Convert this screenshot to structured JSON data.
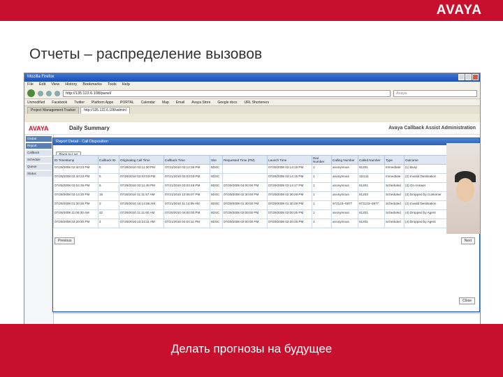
{
  "logo": "AVAYA",
  "slide_title": "Отчеты – распределение вызовов",
  "caption": "Делать прогнозы на будущее",
  "browser": {
    "menu": [
      "File",
      "Edit",
      "View",
      "History",
      "Bookmarks",
      "Tools",
      "Help"
    ],
    "url": "http://135.122.6.108/panel/",
    "search_placeholder": "Avaya",
    "bookmarks": [
      "Unmodified",
      "Facebook",
      "Twitter",
      "Platform Apps",
      "PORTAL",
      "Calendar",
      "Map",
      "Email",
      "Avaya Store",
      "Google docs",
      "URL Shorteners"
    ],
    "tabs": [
      "Project Management Tracker",
      "http://135.122.6.108/admin/"
    ]
  },
  "app": {
    "logo": "AVAYA",
    "title": "Avaya Callback Assist Administration",
    "page": "Daily Summary",
    "sidebar": [
      "Global",
      "Report",
      "Callback",
      "Schedule",
      "Queue",
      "Status"
    ]
  },
  "report": {
    "title": "Report Detail - Call Disposition",
    "back_label": "Back to List",
    "headers": [
      "ID Timestamp",
      "Callback ID",
      "Originating Call Time",
      "Callback Time",
      "Site",
      "Requested Time (PM)",
      "Launch Time",
      "Dial Number",
      "Calling Number",
      "Called Number",
      "Type",
      "Outcome"
    ],
    "rows": [
      [
        "07/29/2008 02:40:23 PM",
        "6",
        "07/28/2010 03:11:30 PM",
        "07/21/2010 03:12:39 PM",
        "6DSC",
        "",
        "07/29/2008 02:14:15 PM",
        "1",
        "anonymous",
        "61201",
        "Immediate",
        "(1) Busy"
      ],
      [
        "07/29/2008 02:40:23 PM",
        "5",
        "07/29/2010 02:03:03 PM",
        "07/21/2010 03:03:03 PM",
        "6DSC",
        "",
        "07/29/2008 02:14:15 PM",
        "1",
        "anonymous",
        "111111",
        "Immediate",
        "(2) Invalid Destination"
      ],
      [
        "07/29/2008 02:04:35 PM",
        "5",
        "07/28/2010 02:11:48 PM",
        "07/21/2010 03:03:48 PM",
        "6DSC",
        "07/29/2008 04:00:00 PM",
        "07/29/2008 02:14:17 PM",
        "1",
        "anonymous",
        "61201",
        "Scheduled",
        "(3) On Answer"
      ],
      [
        "07/29/2008 02:14:30 PM",
        "15",
        "07/28/2010 11:11:57 AM",
        "07/21/2010 12:06:07 PM",
        "6DSC",
        "07/29/2008 02:30:00 PM",
        "07/29/2008 02:30:26 PM",
        "1",
        "anonymous",
        "61203",
        "Scheduled",
        "(3) Dropped by Customer"
      ],
      [
        "07/29/2008 01:30:35 PM",
        "2",
        "07/28/2010 10:14:68 AM",
        "07/21/2010 11:14:09 AM",
        "6DSC",
        "07/29/2008 01:30:00 PM",
        "07/29/2008 01:30:29 PM",
        "1",
        "972123–0877",
        "972123–0877",
        "Scheduled",
        "(2) Invalid Destination"
      ],
      [
        "07/29/2008 11:06:30 AM",
        "22",
        "07/29/2010 11:11:60 AM",
        "07/20/2010 04:00:00 PM",
        "6DSC",
        "07/29/2008 02:00:00 PM",
        "07/29/2008 02:00:25 PM",
        "1",
        "anonymous",
        "61201",
        "Scheduled",
        "(4) Dropped by Agent"
      ],
      [
        "07/29/2008 02:20:30 PM",
        "4",
        "07/28/2010 10:23:11 AM",
        "07/21/2010 04:04:11 PM",
        "6DSC",
        "07/29/2008 02:00:00 PM",
        "07/29/2008 02:20:25 PM",
        "1",
        "anonymous",
        "61201",
        "Scheduled",
        "(4) Dropped by Agent"
      ]
    ],
    "prev_label": "Previous",
    "next_label": "Next",
    "close_label": "Close"
  }
}
